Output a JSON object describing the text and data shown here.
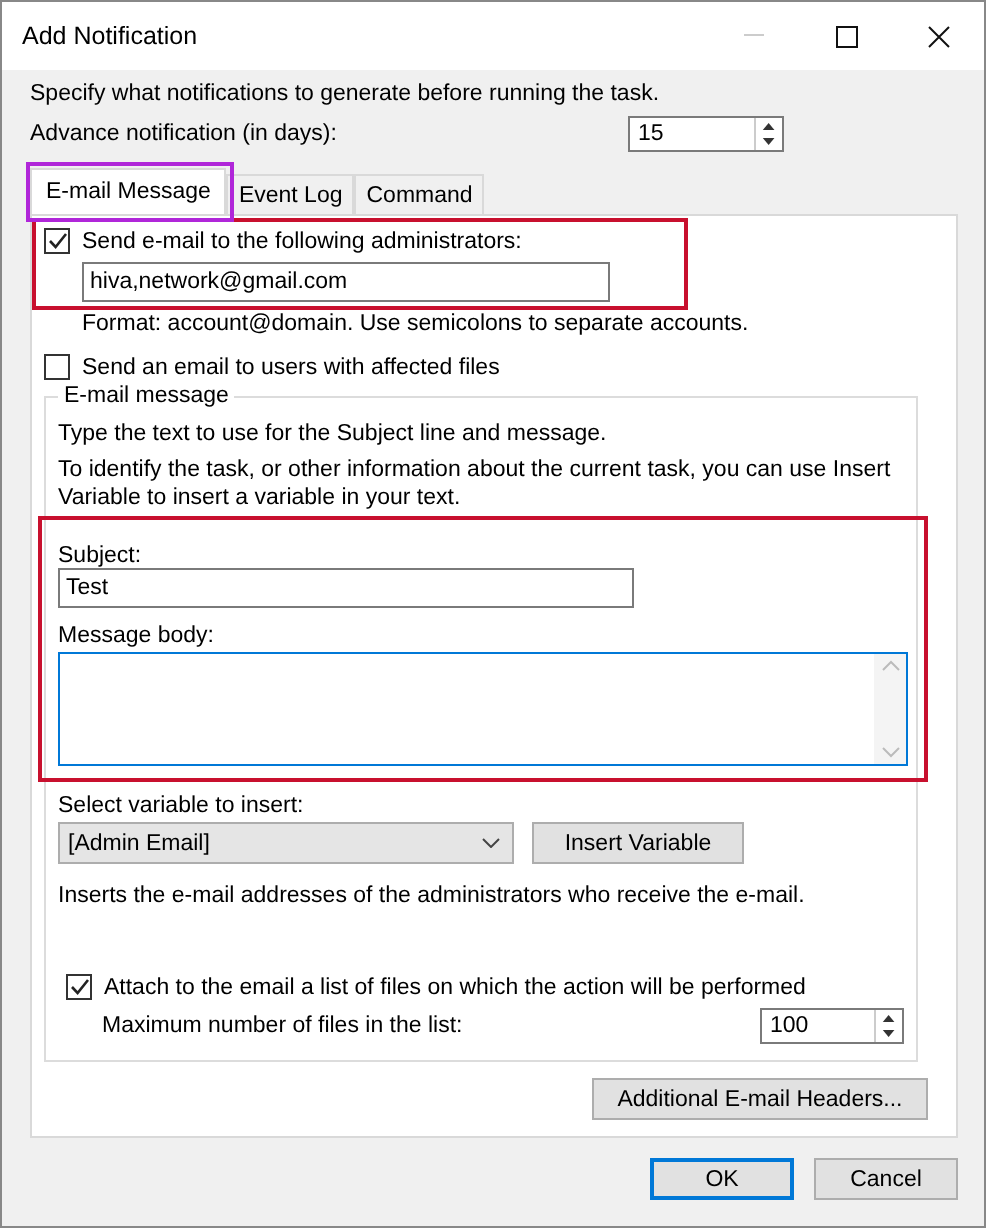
{
  "window": {
    "title": "Add Notification"
  },
  "intro": "Specify what notifications to generate before running the task.",
  "advance": {
    "label": "Advance notification (in days):",
    "value": "15"
  },
  "tabs": [
    {
      "label": "E-mail Message",
      "selected": true
    },
    {
      "label": "Event Log",
      "selected": false
    },
    {
      "label": "Command",
      "selected": false
    }
  ],
  "send_admins": {
    "label": "Send e-mail to the following administrators:",
    "checked": true,
    "value": "hiva,network@gmail.com",
    "hint": "Format: account@domain. Use semicolons to separate accounts."
  },
  "send_users": {
    "label": "Send an email to users with affected files",
    "checked": false
  },
  "group": {
    "title": "E-mail message",
    "text_1": "Type the text to use for the Subject line and message.",
    "text_2": "To identify the task, or other information about the current task, you can use Insert Variable to insert a variable in your text."
  },
  "subject": {
    "label": "Subject:",
    "value": "Test"
  },
  "body": {
    "label": "Message body:"
  },
  "variable": {
    "label": "Select variable to insert:",
    "value": "[Admin Email]",
    "button": "Insert Variable",
    "description": "Inserts the e-mail addresses of the administrators who receive the e-mail."
  },
  "attach": {
    "label": "Attach to the email a list of files on which the action will be performed",
    "checked": true,
    "max_label": "Maximum number of files in the list:",
    "max_value": "100"
  },
  "headers_button": "Additional E-mail Headers...",
  "buttons": [
    {
      "label": "OK",
      "default": true
    },
    {
      "label": "Cancel",
      "default": false
    }
  ]
}
